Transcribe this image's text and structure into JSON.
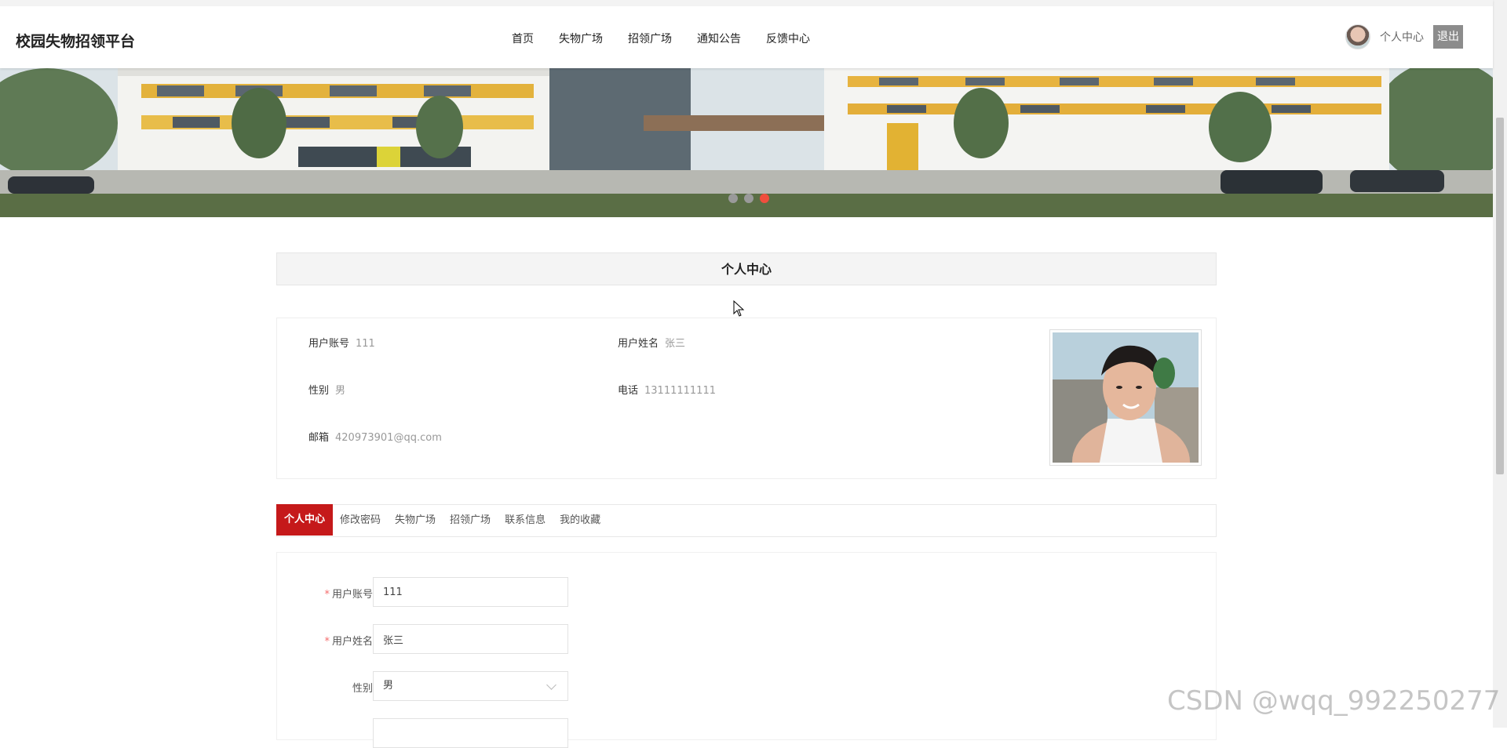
{
  "header": {
    "brand": "校园失物招领平台",
    "nav": [
      "首页",
      "失物广场",
      "招领广场",
      "通知公告",
      "反馈中心"
    ],
    "user_center_label": "个人中心",
    "logout_label": "退出"
  },
  "banner": {
    "dots": 3,
    "active_dot": 3
  },
  "profile": {
    "section_title": "个人中心",
    "fields": [
      {
        "label": "用户账号",
        "value": "111"
      },
      {
        "label": "用户姓名",
        "value": "张三"
      },
      {
        "label": "性别",
        "value": "男"
      },
      {
        "label": "电话",
        "value": "13111111111"
      },
      {
        "label": "邮箱",
        "value": "420973901@qq.com"
      }
    ]
  },
  "tabs": [
    {
      "label": "个人中心",
      "active": true
    },
    {
      "label": "修改密码",
      "active": false
    },
    {
      "label": "失物广场",
      "active": false
    },
    {
      "label": "招领广场",
      "active": false
    },
    {
      "label": "联系信息",
      "active": false
    },
    {
      "label": "我的收藏",
      "active": false
    }
  ],
  "form": {
    "account": {
      "label": "用户账号",
      "value": "111",
      "required": true
    },
    "name": {
      "label": "用户姓名",
      "value": "张三",
      "required": true
    },
    "gender": {
      "label": "性别",
      "value": "男",
      "required": false
    }
  },
  "watermark": "CSDN @wqq_992250277",
  "colors": {
    "accent": "#c5191a",
    "active_dot": "#f04e3e",
    "logout_bg": "#8c8c8c"
  }
}
